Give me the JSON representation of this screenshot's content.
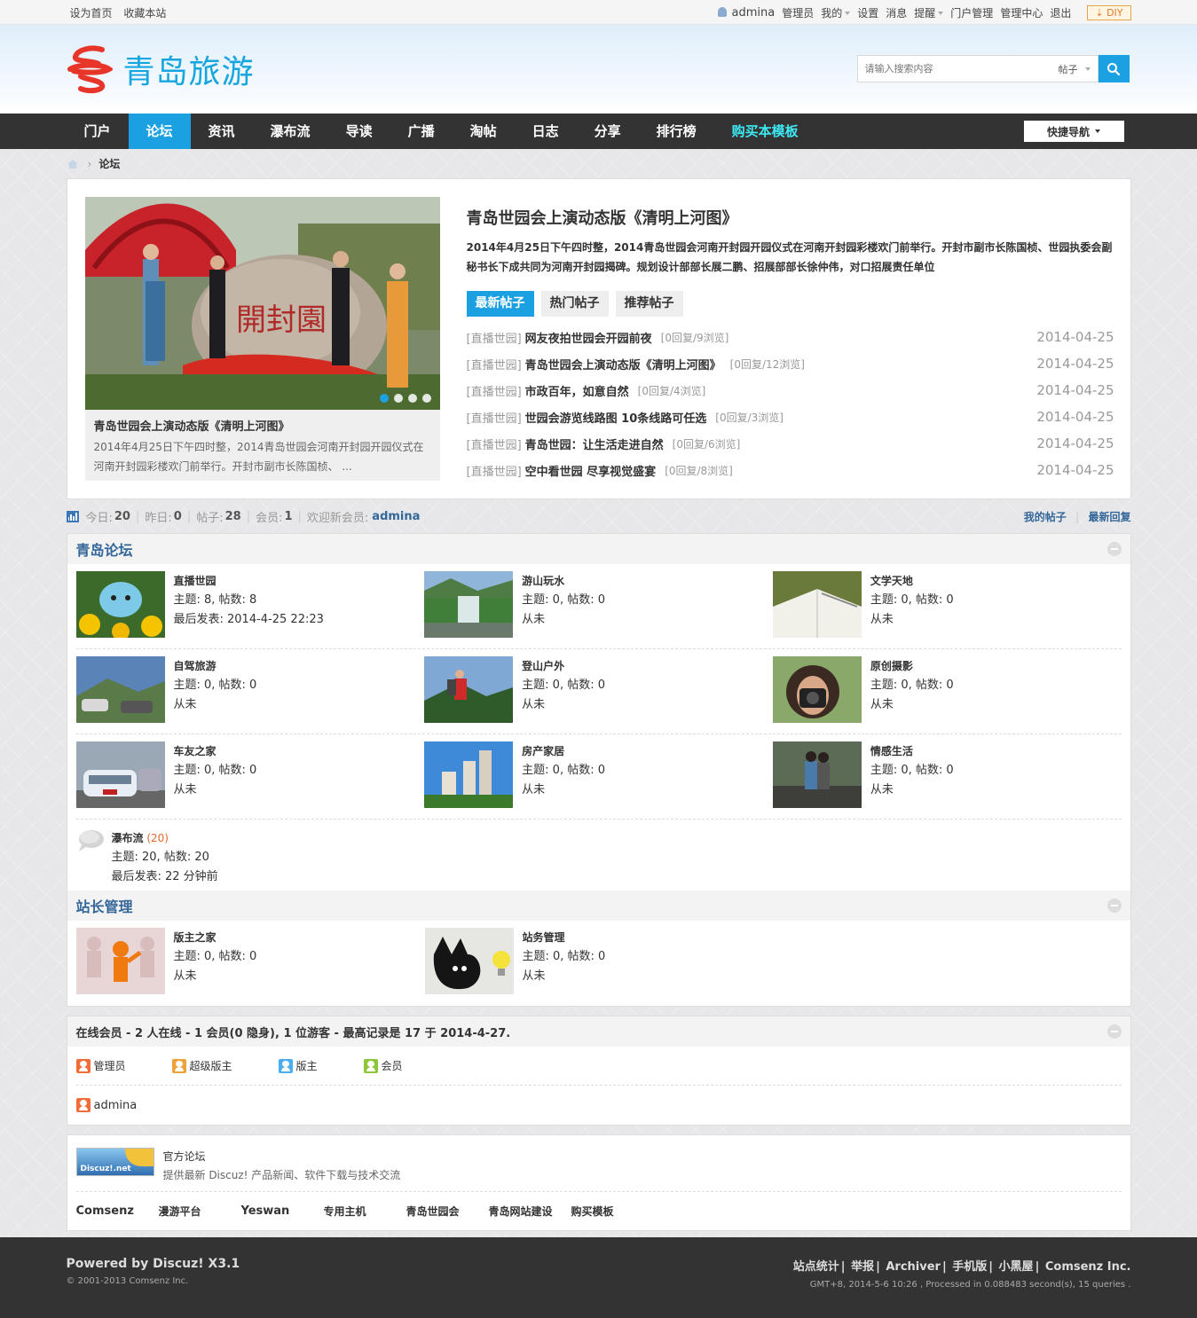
{
  "topbar": {
    "left": [
      "设为首页",
      "收藏本站"
    ],
    "username": "admina",
    "links": [
      "管理员",
      "我的",
      "设置",
      "消息",
      "提醒",
      "门户管理",
      "管理中心",
      "退出"
    ],
    "diy": "DIY"
  },
  "header": {
    "logo_text": "青岛旅游",
    "search_placeholder": "请输入搜索内容",
    "search_type": "帖子"
  },
  "nav": {
    "items": [
      "门户",
      "论坛",
      "资讯",
      "瀑布流",
      "导读",
      "广播",
      "淘帖",
      "日志",
      "分享",
      "排行榜",
      "购买本模板"
    ],
    "active": "论坛",
    "quick": "快捷导航"
  },
  "breadcrumb": {
    "current": "论坛"
  },
  "featured": {
    "slide_title": "青岛世园会上演动态版《清明上河图》",
    "slide_desc": "2014年4月25日下午四时整，2014青岛世园会河南开封园开园仪式在河南开封园彩楼欢门前举行。开封市副市长陈国桢、 ...",
    "title": "青岛世园会上演动态版《清明上河图》",
    "desc": "2014年4月25日下午四时整，2014青岛世园会河南开封园开园仪式在河南开封园彩楼欢门前举行。开封市副市长陈国桢、世园执委会副秘书长下成共同为河南开封园揭碑。规划设计部部长展二鹏、招展部部长徐仲伟，对口招展责任单位",
    "tabs": [
      "最新帖子",
      "热门帖子",
      "推荐帖子"
    ],
    "posts": [
      {
        "cat": "[直播世园]",
        "title": "网友夜拍世园会开园前夜",
        "meta": "[0回复/9浏览]",
        "date": "2014-04-25"
      },
      {
        "cat": "[直播世园]",
        "title": "青岛世园会上演动态版《清明上河图》",
        "meta": "[0回复/12浏览]",
        "date": "2014-04-25"
      },
      {
        "cat": "[直播世园]",
        "title": "市政百年，如意自然",
        "meta": "[0回复/4浏览]",
        "date": "2014-04-25"
      },
      {
        "cat": "[直播世园]",
        "title": "世园会游览线路图 10条线路可任选",
        "meta": "[0回复/3浏览]",
        "date": "2014-04-25"
      },
      {
        "cat": "[直播世园]",
        "title": "青岛世园：让生活走进自然",
        "meta": "[0回复/6浏览]",
        "date": "2014-04-25"
      },
      {
        "cat": "[直播世园]",
        "title": "空中看世园 尽享视觉盛宴",
        "meta": "[0回复/8浏览]",
        "date": "2014-04-25"
      }
    ]
  },
  "stats": {
    "today_label": "今日:",
    "today": "20",
    "yesterday_label": "昨日:",
    "yesterday": "0",
    "posts_label": "帖子:",
    "posts": "28",
    "members_label": "会员:",
    "members": "1",
    "welcome_label": "欢迎新会员:",
    "newuser": "admina",
    "my_posts": "我的帖子",
    "latest_reply": "最新回复"
  },
  "forum_cat1": {
    "title": "青岛论坛",
    "forums": [
      {
        "name": "直播世园",
        "count": "主题: 8, 帖数: 8",
        "last": "最后发表: 2014-4-25 22:23"
      },
      {
        "name": "游山玩水",
        "count": "主题: 0, 帖数: 0",
        "last": "从未"
      },
      {
        "name": "文学天地",
        "count": "主题: 0, 帖数: 0",
        "last": "从未"
      },
      {
        "name": "自驾旅游",
        "count": "主题: 0, 帖数: 0",
        "last": "从未"
      },
      {
        "name": "登山户外",
        "count": "主题: 0, 帖数: 0",
        "last": "从未"
      },
      {
        "name": "原创摄影",
        "count": "主题: 0, 帖数: 0",
        "last": "从未"
      },
      {
        "name": "车友之家",
        "count": "主题: 0, 帖数: 0",
        "last": "从未"
      },
      {
        "name": "房产家居",
        "count": "主题: 0, 帖数: 0",
        "last": "从未"
      },
      {
        "name": "情感生活",
        "count": "主题: 0, 帖数: 0",
        "last": "从未"
      }
    ],
    "waterfall": {
      "name": "瀑布流",
      "new": "(20)",
      "count": "主题: 20, 帖数: 20",
      "last": "最后发表: 22 分钟前"
    }
  },
  "forum_cat2": {
    "title": "站长管理",
    "forums": [
      {
        "name": "版主之家",
        "count": "主题: 0, 帖数: 0",
        "last": "从未"
      },
      {
        "name": "站务管理",
        "count": "主题: 0, 帖数: 0",
        "last": "从未"
      }
    ]
  },
  "online": {
    "header": "在线会员 - 2 人在线 - 1 会员(0 隐身), 1 位游客 - 最高记录是 17 于 2014-4-27.",
    "legend": [
      "管理员",
      "超级版主",
      "版主",
      "会员"
    ],
    "users": [
      "admina"
    ]
  },
  "links": {
    "logo_text": "Discuz!.net",
    "name": "官方论坛",
    "desc": "提供最新 Discuz! 产品新闻、软件下载与技术交流",
    "items": [
      "Comsenz",
      "漫游平台",
      "Yeswan",
      "专用主机",
      "青岛世园会",
      "青岛网站建设",
      "购买模板"
    ]
  },
  "footer": {
    "powered": "Powered by Discuz! X3.1",
    "copyright": "© 2001-2013 Comsenz Inc.",
    "links": [
      "站点统计",
      "举报",
      "Archiver",
      "手机版",
      "小黑屋",
      "Comsenz Inc."
    ],
    "gmt": "GMT+8, 2014-5-6 10:26 , Processed in 0.088483 second(s), 15 queries ."
  },
  "colors": {
    "accent": "#1ba1e2",
    "link": "#336699",
    "nav_bg": "#333333",
    "buy": "#3ee8f3"
  }
}
